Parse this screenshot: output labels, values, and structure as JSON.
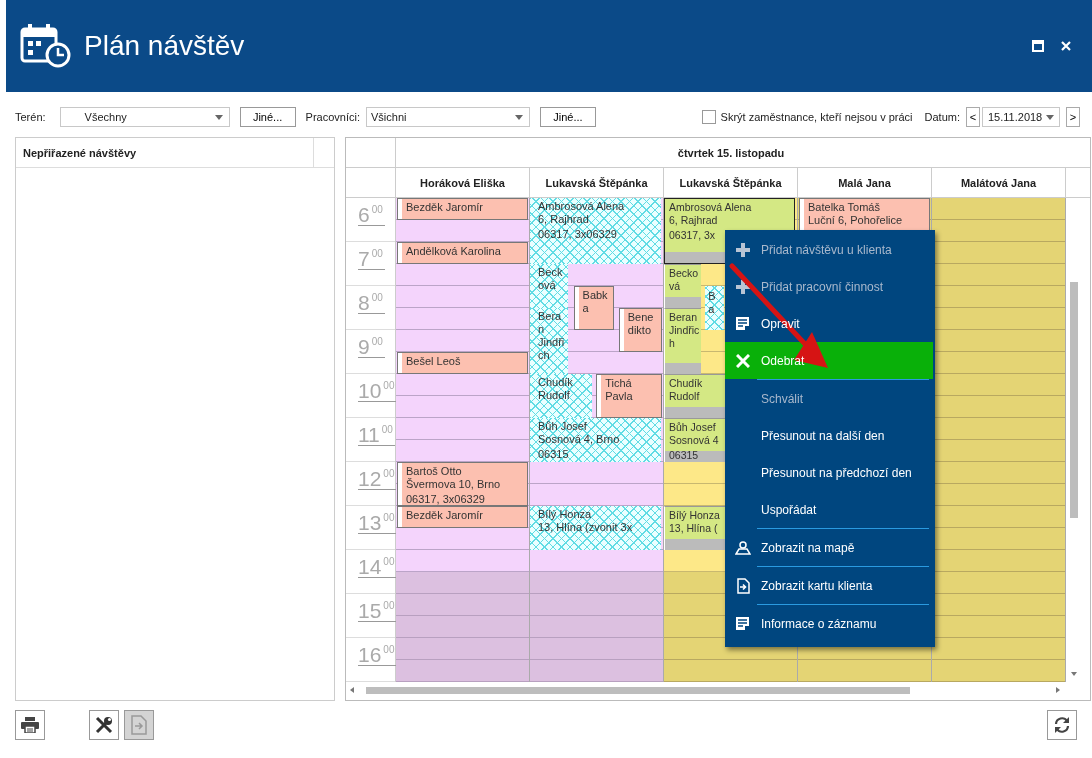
{
  "window": {
    "title": "Plán návštěv"
  },
  "toolbar": {
    "terrain": {
      "label": "Terén:",
      "value": "Všechny",
      "button": "Jiné..."
    },
    "workers": {
      "label": "Pracovníci:",
      "value": "Všichni",
      "button": "Jiné..."
    },
    "hide_absent": {
      "label": "Skrýt zaměstnance, kteří nejsou v práci",
      "checked": false
    },
    "date": {
      "label": "Datum:",
      "prev": "<",
      "value": "15.11.2018",
      "next": ">"
    }
  },
  "unassigned": {
    "title": "Nepřiřazené návštěvy"
  },
  "calendar": {
    "day": "čtvrtek 15. listopadu",
    "hours": [
      "6$^{00}$",
      "7$^{00}$",
      "8$^{00}$",
      "9$^{00}$",
      "10$^{00}$",
      "11$^{00}$",
      "12$^{00}$",
      "13$^{00}$",
      "14$^{00}$",
      "15$^{00}$",
      "16$^{00}$"
    ],
    "columns": [
      {
        "name": "Horáková Eliška",
        "kind": "pink",
        "events": [
          {
            "kind": "visit",
            "selected": false,
            "lines": [
              "Bezděk Jaromír"
            ]
          },
          {
            "kind": "visit",
            "selected": false,
            "lines": [
              "Andělková Karolina"
            ]
          },
          {
            "kind": "visit",
            "selected": false,
            "lines": [
              "Bešel Leoš"
            ]
          },
          {
            "kind": "visit",
            "selected": false,
            "lines": [
              "Bartoš Otto",
              "Švermova 10, Brno",
              "06317, 3x06329"
            ]
          },
          {
            "kind": "visit",
            "selected": false,
            "lines": [
              "Bezděk Jaromír"
            ]
          }
        ]
      },
      {
        "name": "Lukavská Štěpánka",
        "kind": "pink",
        "events": [
          {
            "kind": "hatched",
            "selected": false,
            "lines": [
              "Ambrosová Alena",
              "6, Rajhrad",
              "06317, 3x06329"
            ]
          },
          {
            "kind": "hatched",
            "selected": false,
            "lines": [
              "Becková"
            ]
          },
          {
            "kind": "visit",
            "selected": false,
            "lines": [
              "Babka"
            ]
          },
          {
            "kind": "visit",
            "selected": false,
            "lines": [
              "Benedikto"
            ]
          },
          {
            "kind": "hatched",
            "selected": false,
            "lines": [
              "Beran Jindřich"
            ]
          },
          {
            "kind": "hatched",
            "selected": false,
            "lines": [
              "Chudík Rudolf"
            ]
          },
          {
            "kind": "visit",
            "selected": false,
            "lines": [
              "Tichá Pavla"
            ]
          },
          {
            "kind": "hatched",
            "selected": false,
            "lines": [
              "Bůh Josef",
              "Sosnová 4, Brno",
              "06315"
            ]
          },
          {
            "kind": "hatched",
            "selected": false,
            "lines": [
              "Bílý Honza",
              "13, Hlína (zvonit 3x"
            ]
          }
        ]
      },
      {
        "name": "Lukavská Štěpánka",
        "kind": "yellow",
        "events": [
          {
            "kind": "approved",
            "selected": true,
            "lines": [
              "Ambrosová Alena",
              "6, Rajhrad",
              "06317, 3x"
            ]
          },
          {
            "kind": "approved",
            "selected": false,
            "lines": [
              "Becková"
            ]
          },
          {
            "kind": "hatched",
            "selected": false,
            "lines": [
              "B",
              "a"
            ]
          },
          {
            "kind": "approved",
            "selected": false,
            "lines": [
              "Beran Jindřich"
            ]
          },
          {
            "kind": "approved",
            "selected": false,
            "lines": [
              "Chudík Rudolf"
            ]
          },
          {
            "kind": "approved",
            "selected": false,
            "lines": [
              "Bůh Josef",
              "Sosnová 4",
              "06315"
            ]
          },
          {
            "kind": "approved",
            "selected": false,
            "lines": [
              "Bílý Honza",
              "13, Hlína ("
            ]
          }
        ]
      },
      {
        "name": "Malá Jana",
        "kind": "off",
        "events": [
          {
            "kind": "visit",
            "selected": false,
            "lines": [
              "Batelka Tomáš",
              "Luční 6, Pohořelice"
            ]
          }
        ]
      },
      {
        "name": "Malátová Jana",
        "kind": "off"
      }
    ]
  },
  "menu": {
    "items": [
      {
        "label": "Přidat návštěvu u klienta",
        "kind": "add",
        "disabled": true,
        "selected": false,
        "separator": false
      },
      {
        "label": "Přidat pracovní činnost",
        "kind": "add",
        "disabled": true,
        "selected": false,
        "separator": false
      },
      {
        "label": "Opravit",
        "kind": "edit",
        "disabled": false,
        "selected": false,
        "separator": false
      },
      {
        "label": "Odebrat",
        "kind": "remove",
        "disabled": false,
        "selected": true,
        "separator": true
      },
      {
        "label": "Schválit",
        "kind": "plain",
        "disabled": true,
        "selected": false,
        "separator": false
      },
      {
        "label": "Přesunout na další den",
        "kind": "plain",
        "disabled": false,
        "selected": false,
        "separator": false
      },
      {
        "label": "Přesunout na předchozí den",
        "kind": "plain",
        "disabled": false,
        "selected": false,
        "separator": false
      },
      {
        "label": "Uspořádat",
        "kind": "plain",
        "disabled": false,
        "selected": false,
        "separator": true
      },
      {
        "label": "Zobrazit na mapě",
        "kind": "map",
        "disabled": false,
        "selected": false,
        "separator": true
      },
      {
        "label": "Zobrazit kartu klienta",
        "kind": "card",
        "disabled": false,
        "selected": false,
        "separator": true
      },
      {
        "label": "Informace o záznamu",
        "kind": "edit",
        "disabled": false,
        "selected": false,
        "separator": false
      }
    ]
  },
  "footer": {
    "buttons": [
      {
        "kind": "print",
        "disabled": false
      },
      {
        "kind": "tools",
        "disabled": false
      },
      {
        "kind": "card",
        "disabled": true
      },
      {
        "kind": "refresh",
        "disabled": false
      }
    ]
  }
}
